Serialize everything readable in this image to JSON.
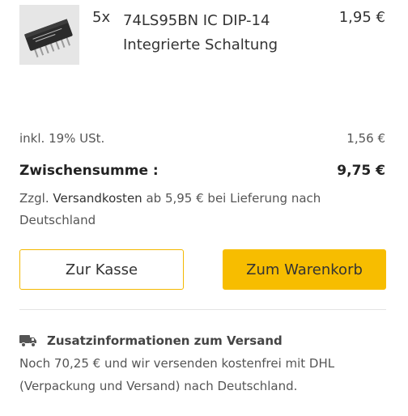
{
  "cart_item": {
    "image_alt": "74LS95BN IC DIP-14",
    "quantity": "5x",
    "name_line1": "74LS95BN IC DIP-14",
    "name_line2": "Integrierte Schaltung",
    "price": "1,95 €"
  },
  "summary": {
    "tax_label": "inkl. 19% USt.",
    "tax_value": "1,56 €",
    "subtotal_label": "Zwischensumme :",
    "subtotal_value": "9,75 €",
    "shipping_prefix": "Zzgl.",
    "shipping_link": "Versandkosten",
    "shipping_suffix": "ab 5,95 € bei Lieferung nach Deutschland"
  },
  "buttons": {
    "checkout_label": "Zur Kasse",
    "cart_label": "Zum Warenkorb"
  },
  "shipping_info": {
    "icon": "truck-icon",
    "heading": "Zusatzinformationen zum Versand",
    "text": "Noch 70,25 € und wir versenden kostenfrei mit DHL (Verpackung und Versand) nach Deutschland."
  },
  "colors": {
    "accent": "#f7bd00",
    "text": "#333333",
    "muted": "#555555"
  }
}
